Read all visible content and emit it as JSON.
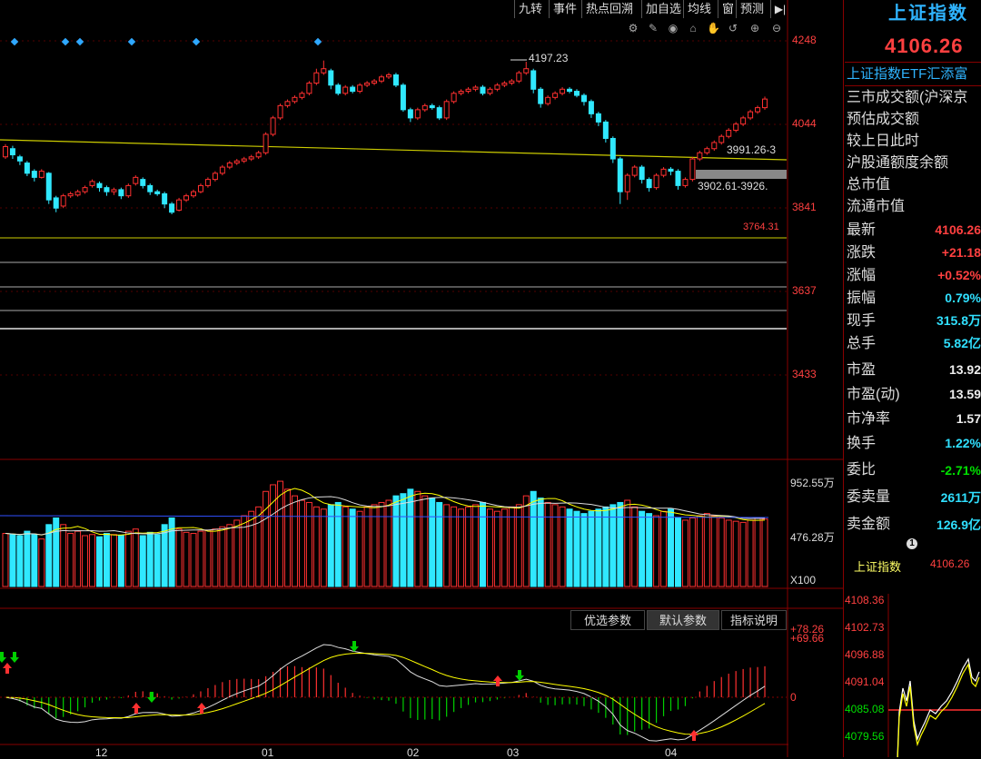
{
  "toolbar": {
    "items": [
      "九转",
      "事件",
      "热点回溯",
      "加自选",
      "均线",
      "窗",
      "预测"
    ],
    "collapse_icon": "panel-collapse-icon"
  },
  "chart_controls": [
    "settings-icon",
    "draw-icon",
    "eye-icon",
    "lock-icon",
    "hand-icon",
    "reset-icon",
    "zoom-in-icon",
    "zoom-out-icon"
  ],
  "price_axis": {
    "labels": [
      "4248",
      "4044",
      "3841",
      "3637",
      "3433"
    ]
  },
  "annotations": {
    "high": "4197.23",
    "range1": "3991.26-3",
    "range2": "3902.61-3926.",
    "level": "3764.31"
  },
  "volume_axis": {
    "labels": [
      "952.55万",
      "476.28万"
    ],
    "multiplier": "X100"
  },
  "macd_axis": {
    "labels": [
      "+78.26",
      "+69.66",
      "0"
    ]
  },
  "time_axis": {
    "labels": [
      "12",
      "01",
      "02",
      "03",
      "04"
    ]
  },
  "indicator_tabs": [
    "优选参数",
    "默认参数",
    "指标说明"
  ],
  "right_panel": {
    "title": "上证指数",
    "price": "4106.26",
    "etf_label": "上证指数ETF汇添富",
    "info_rows": [
      "三市成交额(沪深京",
      "预估成交额",
      "较上日此时",
      "沪股通额度余额",
      "总市值",
      "流通市值"
    ],
    "quote_rows": [
      {
        "label": "最新",
        "value": "4106.26",
        "color": "red"
      },
      {
        "label": "涨跌",
        "value": "+21.18",
        "color": "red"
      },
      {
        "label": "涨幅",
        "value": "+0.52%",
        "color": "red"
      },
      {
        "label": "振幅",
        "value": "0.79%",
        "color": "cyan"
      },
      {
        "label": "现手",
        "value": "315.8万",
        "color": "cyan"
      },
      {
        "label": "总手",
        "value": "5.82亿",
        "color": "cyan"
      }
    ],
    "valuation_rows": [
      {
        "label": "市盈",
        "value": "13.92",
        "color": "white"
      },
      {
        "label": "市盈(动)",
        "value": "13.59",
        "color": "white"
      },
      {
        "label": "市净率",
        "value": "1.57",
        "color": "white"
      },
      {
        "label": "换手",
        "value": "1.22%",
        "color": "cyan"
      }
    ],
    "order_rows": [
      {
        "label": "委比",
        "value": "-2.71%",
        "color": "green"
      },
      {
        "label": "委卖量",
        "value": "2611万",
        "color": "cyan"
      },
      {
        "label": "卖金额",
        "value": "126.9亿",
        "color": "cyan"
      }
    ],
    "page_index": "1",
    "mini_name": "上证指数",
    "mini_price": "4106.26",
    "mini_axis": [
      "4108.36",
      "4102.73",
      "4096.88",
      "4091.04",
      "4085.08",
      "4079.56"
    ]
  },
  "chart_data": {
    "type": "candlestick",
    "candles": [
      [
        3965,
        3990,
        3996,
        3960
      ],
      [
        3985,
        3970,
        3992,
        3960
      ],
      [
        3965,
        3955,
        3970,
        3945
      ],
      [
        3950,
        3925,
        3955,
        3918
      ],
      [
        3930,
        3915,
        3935,
        3905
      ],
      [
        3915,
        3930,
        3935,
        3912
      ],
      [
        3925,
        3860,
        3928,
        3850
      ],
      [
        3865,
        3840,
        3870,
        3830
      ],
      [
        3845,
        3870,
        3875,
        3840
      ],
      [
        3870,
        3875,
        3880,
        3865
      ],
      [
        3872,
        3880,
        3885,
        3868
      ],
      [
        3880,
        3890,
        3895,
        3875
      ],
      [
        3895,
        3905,
        3910,
        3890
      ],
      [
        3900,
        3890,
        3905,
        3880
      ],
      [
        3890,
        3880,
        3895,
        3870
      ],
      [
        3880,
        3885,
        3890,
        3872
      ],
      [
        3885,
        3870,
        3890,
        3862
      ],
      [
        3870,
        3895,
        3900,
        3865
      ],
      [
        3900,
        3915,
        3920,
        3895
      ],
      [
        3910,
        3895,
        3915,
        3888
      ],
      [
        3895,
        3880,
        3900,
        3872
      ],
      [
        3880,
        3875,
        3885,
        3870
      ],
      [
        3875,
        3850,
        3880,
        3840
      ],
      [
        3850,
        3830,
        3855,
        3825
      ],
      [
        3835,
        3860,
        3865,
        3832
      ],
      [
        3860,
        3870,
        3875,
        3855
      ],
      [
        3870,
        3880,
        3885,
        3865
      ],
      [
        3880,
        3895,
        3900,
        3876
      ],
      [
        3895,
        3910,
        3915,
        3890
      ],
      [
        3910,
        3925,
        3930,
        3905
      ],
      [
        3925,
        3940,
        3945,
        3920
      ],
      [
        3940,
        3950,
        3955,
        3935
      ],
      [
        3950,
        3955,
        3960,
        3945
      ],
      [
        3955,
        3960,
        3965,
        3950
      ],
      [
        3960,
        3965,
        3970,
        3955
      ],
      [
        3965,
        3975,
        3980,
        3960
      ],
      [
        3975,
        4020,
        4025,
        3970
      ],
      [
        4020,
        4060,
        4065,
        4015
      ],
      [
        4060,
        4090,
        4095,
        4055
      ],
      [
        4090,
        4100,
        4105,
        4085
      ],
      [
        4100,
        4110,
        4115,
        4095
      ],
      [
        4110,
        4120,
        4125,
        4105
      ],
      [
        4120,
        4145,
        4150,
        4115
      ],
      [
        4145,
        4170,
        4180,
        4140
      ],
      [
        4170,
        4180,
        4200,
        4165
      ],
      [
        4175,
        4140,
        4180,
        4130
      ],
      [
        4140,
        4120,
        4145,
        4115
      ],
      [
        4120,
        4135,
        4140,
        4115
      ],
      [
        4135,
        4125,
        4140,
        4120
      ],
      [
        4125,
        4140,
        4145,
        4120
      ],
      [
        4140,
        4145,
        4150,
        4135
      ],
      [
        4145,
        4150,
        4155,
        4140
      ],
      [
        4150,
        4160,
        4165,
        4145
      ],
      [
        4160,
        4165,
        4170,
        4155
      ],
      [
        4165,
        4140,
        4170,
        4135
      ],
      [
        4140,
        4080,
        4145,
        4075
      ],
      [
        4080,
        4060,
        4085,
        4050
      ],
      [
        4060,
        4080,
        4085,
        4055
      ],
      [
        4080,
        4090,
        4095,
        4075
      ],
      [
        4090,
        4085,
        4095,
        4080
      ],
      [
        4085,
        4060,
        4090,
        4055
      ],
      [
        4060,
        4100,
        4105,
        4055
      ],
      [
        4100,
        4120,
        4125,
        4095
      ],
      [
        4120,
        4125,
        4130,
        4115
      ],
      [
        4125,
        4130,
        4135,
        4120
      ],
      [
        4130,
        4135,
        4140,
        4125
      ],
      [
        4135,
        4120,
        4140,
        4115
      ],
      [
        4120,
        4130,
        4135,
        4115
      ],
      [
        4130,
        4140,
        4145,
        4125
      ],
      [
        4140,
        4145,
        4150,
        4135
      ],
      [
        4145,
        4150,
        4155,
        4140
      ],
      [
        4150,
        4170,
        4175,
        4145
      ],
      [
        4170,
        4180,
        4197,
        4165
      ],
      [
        4175,
        4130,
        4180,
        4120
      ],
      [
        4130,
        4095,
        4135,
        4085
      ],
      [
        4095,
        4110,
        4115,
        4090
      ],
      [
        4110,
        4120,
        4125,
        4105
      ],
      [
        4120,
        4130,
        4135,
        4115
      ],
      [
        4130,
        4125,
        4135,
        4120
      ],
      [
        4125,
        4115,
        4130,
        4110
      ],
      [
        4115,
        4100,
        4120,
        4090
      ],
      [
        4100,
        4070,
        4105,
        4060
      ],
      [
        4070,
        4050,
        4075,
        4040
      ],
      [
        4050,
        4010,
        4055,
        4000
      ],
      [
        4010,
        3960,
        4015,
        3950
      ],
      [
        3960,
        3880,
        3965,
        3850
      ],
      [
        3880,
        3920,
        3925,
        3860
      ],
      [
        3920,
        3940,
        3945,
        3915
      ],
      [
        3940,
        3910,
        3945,
        3900
      ],
      [
        3910,
        3890,
        3915,
        3880
      ],
      [
        3890,
        3920,
        3925,
        3885
      ],
      [
        3920,
        3935,
        3940,
        3915
      ],
      [
        3935,
        3930,
        3940,
        3920
      ],
      [
        3930,
        3895,
        3935,
        3885
      ],
      [
        3895,
        3910,
        3915,
        3890
      ],
      [
        3910,
        3960,
        3965,
        3905
      ],
      [
        3960,
        3975,
        3980,
        3955
      ],
      [
        3975,
        3985,
        3990,
        3970
      ],
      [
        3985,
        4000,
        4005,
        3980
      ],
      [
        4000,
        4015,
        4020,
        3995
      ],
      [
        4015,
        4030,
        4035,
        4010
      ],
      [
        4030,
        4045,
        4050,
        4025
      ],
      [
        4045,
        4060,
        4065,
        4040
      ],
      [
        4060,
        4075,
        4080,
        4055
      ],
      [
        4075,
        4085,
        4090,
        4070
      ],
      [
        4085,
        4106,
        4112,
        4080
      ]
    ],
    "volume": [
      480,
      470,
      460,
      500,
      470,
      430,
      560,
      620,
      560,
      480,
      500,
      460,
      470,
      450,
      480,
      470,
      460,
      500,
      520,
      460,
      490,
      470,
      560,
      620,
      520,
      490,
      480,
      500,
      510,
      520,
      540,
      560,
      600,
      640,
      680,
      720,
      860,
      920,
      952,
      880,
      820,
      780,
      760,
      720,
      700,
      740,
      760,
      720,
      700,
      680,
      720,
      740,
      760,
      780,
      820,
      840,
      880,
      860,
      820,
      800,
      760,
      740,
      720,
      700,
      720,
      740,
      760,
      700,
      680,
      700,
      720,
      740,
      820,
      860,
      800,
      760,
      740,
      720,
      700,
      680,
      660,
      680,
      700,
      720,
      740,
      760,
      780,
      720,
      680,
      660,
      640,
      680,
      700,
      620,
      600,
      620,
      640,
      660,
      640,
      620,
      600,
      590,
      580,
      600,
      620,
      610
    ],
    "volume_axis": [
      476.28,
      952.55
    ],
    "macd_axis_max": 78.26,
    "price_axis": [
      3433,
      4248
    ]
  }
}
